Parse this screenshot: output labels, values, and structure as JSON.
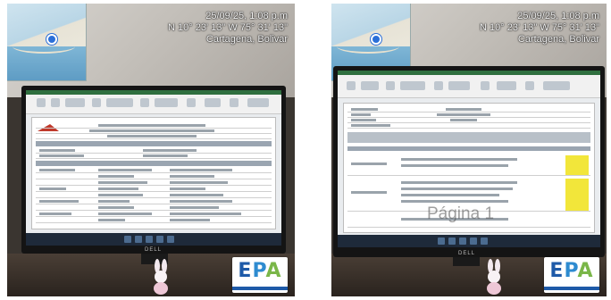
{
  "photos": [
    {
      "id": "left",
      "timestamp_line1": "25/09/25, 1:08 p.m",
      "timestamp_line2": "N 10° 23' 13\" W 75° 31' 13\"",
      "timestamp_line3": "Cartagena, Bolivar",
      "monitor_brand": "DELL",
      "logo_text": "EPA"
    },
    {
      "id": "right",
      "timestamp_line1": "25/09/25, 1:08 p.m",
      "timestamp_line2": "N 10° 23' 13\" W 75° 31' 13\"",
      "timestamp_line3": "Cartagena, Bolivar",
      "monitor_brand": "DELL",
      "watermark": "Página 1",
      "logo_text": "EPA"
    }
  ],
  "colors": {
    "epa_blue": "#1e5aa8",
    "epa_light_blue": "#2e8bd0",
    "epa_green": "#7ab648",
    "highlight_yellow": "#f2e63a",
    "excel_green": "#2f6f3f"
  }
}
